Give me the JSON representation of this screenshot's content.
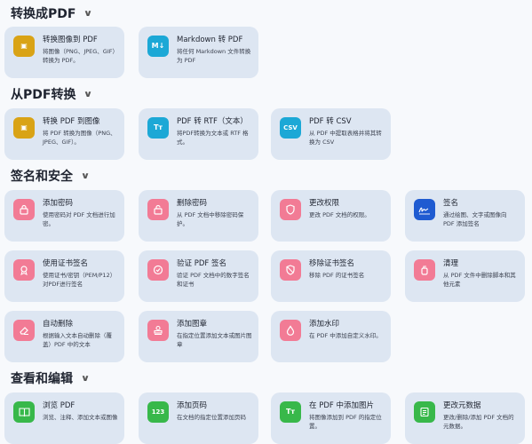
{
  "sections": [
    {
      "title": "转换成PDF",
      "cards": [
        {
          "title": "转换图像到 PDF",
          "desc": "将图像（PNG、JPEG、GIF）转换为 PDF。",
          "icon": "image-icon",
          "color": "#d9a316"
        },
        {
          "title": "Markdown 转 PDF",
          "desc": "将任何 Markdown 文件转换为 PDF",
          "icon": "markdown-icon",
          "color": "#1ca8d6"
        }
      ]
    },
    {
      "title": "从PDF转换",
      "cards": [
        {
          "title": "转换 PDF 到图像",
          "desc": "将 PDF 转换为图像（PNG、JPEG、GIF）。",
          "icon": "image-icon",
          "color": "#d9a316"
        },
        {
          "title": "PDF 转 RTF（文本）",
          "desc": "将PDF转换为文本或 RTF 格式。",
          "icon": "text-icon",
          "color": "#1ca8d6"
        },
        {
          "title": "PDF 转 CSV",
          "desc": "从 PDF 中提取表格并将其转换为 CSV",
          "icon": "csv-icon",
          "color": "#1ca8d6"
        }
      ]
    },
    {
      "title": "签名和安全",
      "cards": [
        {
          "title": "添加密码",
          "desc": "使用密码对 PDF 文档进行加密。",
          "icon": "lock-icon",
          "color": "#f27b95"
        },
        {
          "title": "删除密码",
          "desc": "从 PDF 文档中移除密码保护。",
          "icon": "unlock-icon",
          "color": "#f27b95"
        },
        {
          "title": "更改权限",
          "desc": "更改 PDF 文档的权限。",
          "icon": "shield-icon",
          "color": "#f27b95"
        },
        {
          "title": "签名",
          "desc": "通过绘图、文字或图像向 PDF 添加签名",
          "icon": "signature-icon",
          "color": "#1f5bd1"
        },
        {
          "title": "使用证书签名",
          "desc": "使用证书/密钥（PEM/P12）对PDF进行签名",
          "icon": "certificate-icon",
          "color": "#f27b95"
        },
        {
          "title": "验证 PDF 签名",
          "desc": "验证 PDF 文档中的数字签名和证书",
          "icon": "verify-icon",
          "color": "#f27b95"
        },
        {
          "title": "移除证书签名",
          "desc": "移除 PDF 的证书签名",
          "icon": "remove-cert-icon",
          "color": "#f27b95"
        },
        {
          "title": "清理",
          "desc": "从 PDF 文件中删除脚本和其他元素",
          "icon": "sanitize-icon",
          "color": "#f27b95"
        },
        {
          "title": "自动删除",
          "desc": "根据输入文本自动删除（覆盖）PDF 中的文本",
          "icon": "eraser-icon",
          "color": "#f27b95"
        },
        {
          "title": "添加图章",
          "desc": "在指定位置添加文本或图片图章",
          "icon": "stamp-icon",
          "color": "#f27b95"
        },
        {
          "title": "添加水印",
          "desc": "在 PDF 中添加自定义水印。",
          "icon": "watermark-icon",
          "color": "#f27b95"
        }
      ]
    },
    {
      "title": "查看和编辑",
      "cards": [
        {
          "title": "浏览 PDF",
          "desc": "浏览、注释、添加文本或图像",
          "icon": "book-icon",
          "color": "#38b84a"
        },
        {
          "title": "添加页码",
          "desc": "在文档的指定位置添加页码",
          "icon": "numbers-icon",
          "color": "#38b84a"
        },
        {
          "title": "在 PDF 中添加图片",
          "desc": "将图像添加到 PDF 的指定位置。",
          "icon": "text-icon",
          "color": "#38b84a"
        },
        {
          "title": "更改元数据",
          "desc": "更改/删除/添加 PDF 文档的元数据。",
          "icon": "metadata-icon",
          "color": "#38b84a"
        }
      ]
    }
  ],
  "icons": {
    "image-icon": "▣",
    "markdown-icon": "M↓",
    "text-icon": "Tт",
    "csv-icon": "CSV",
    "lock-icon": "🔒",
    "unlock-icon": "🔓",
    "shield-icon": "⛨",
    "signature-icon": "✍",
    "certificate-icon": "✦",
    "verify-icon": "✓",
    "remove-cert-icon": "⊘",
    "sanitize-icon": "⚗",
    "eraser-icon": "⌫",
    "stamp-icon": "⊥",
    "watermark-icon": "💧",
    "book-icon": "▥",
    "numbers-icon": "123",
    "metadata-icon": "≡"
  }
}
